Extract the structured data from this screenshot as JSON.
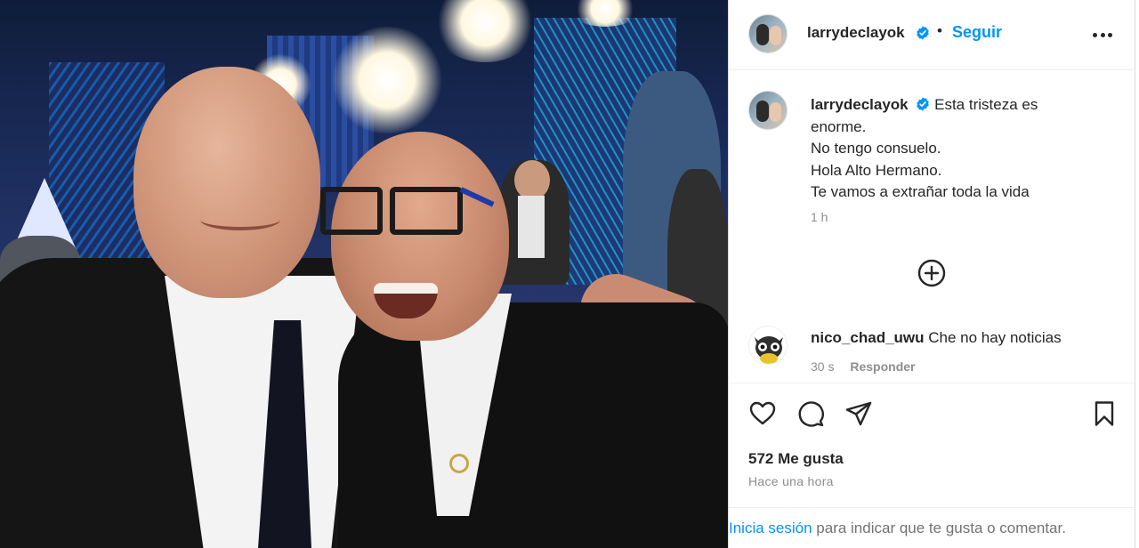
{
  "post": {
    "author": "larrydeclayok",
    "follow_label": "Seguir",
    "separator": "•",
    "caption_lines": [
      "Esta tristeza es",
      "enorme.",
      "No tengo consuelo.",
      "Hola Alto Hermano.",
      "Te vamos a extrañar toda la vida"
    ],
    "caption_time": "1 h",
    "likes": "572 Me gusta",
    "posted_ago": "Hace una hora"
  },
  "comment": {
    "author": "nico_chad_uwu",
    "text": "Che no hay noticias",
    "time": "30 s",
    "reply_label": "Responder"
  },
  "footer": {
    "login_link": "Inicia sesión",
    "login_text": " para indicar que te gusta o comentar."
  },
  "icons": {
    "verified": "verified-badge-icon",
    "more": "more-options-icon",
    "load_more": "plus-circle-icon",
    "like": "heart-icon",
    "comment": "comment-bubble-icon",
    "share": "paper-plane-icon",
    "save": "bookmark-icon"
  },
  "colors": {
    "link_blue": "#0095f6",
    "verified_blue": "#0095f6",
    "text": "#262626",
    "muted": "#8e8e8e"
  }
}
